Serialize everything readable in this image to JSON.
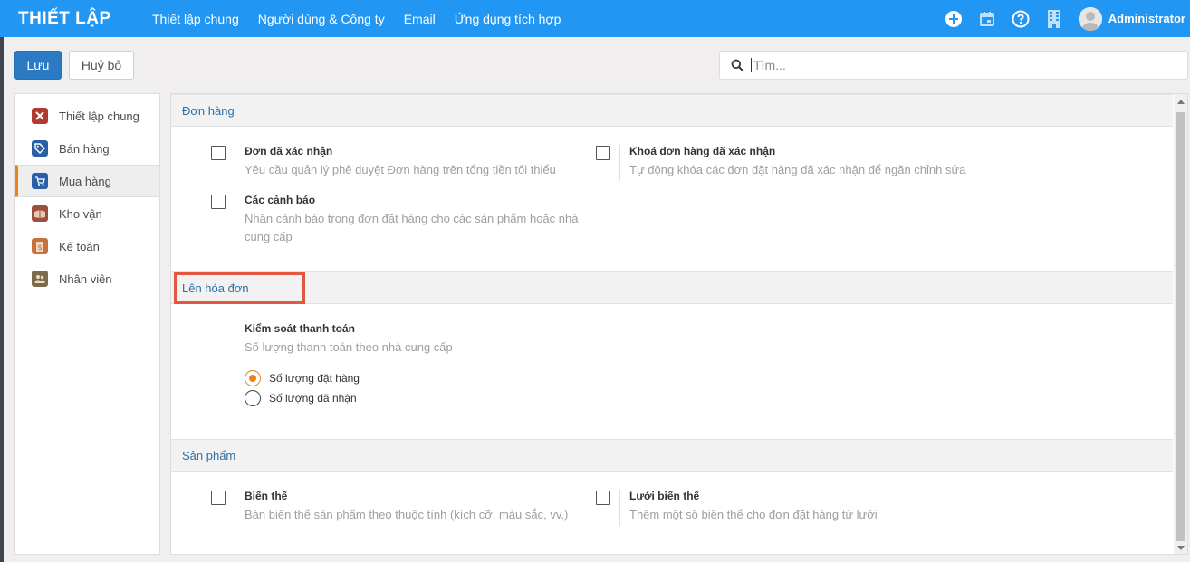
{
  "topbar": {
    "brand": "THIẾT LẬP",
    "nav": [
      "Thiết lập chung",
      "Người dùng & Công ty",
      "Email",
      "Ứng dụng tích hợp"
    ],
    "icons": [
      "plus-circle-icon",
      "calendar-icon",
      "help-icon",
      "building-icon"
    ],
    "user": "Administrator"
  },
  "toolbar": {
    "save_label": "Lưu",
    "cancel_label": "Huỷ bỏ"
  },
  "search": {
    "placeholder": "Tìm..."
  },
  "sidebar": {
    "items": [
      {
        "label": "Thiết lập chung",
        "icon": "tools-icon",
        "color": "#b03a2e"
      },
      {
        "label": "Bán hàng",
        "icon": "tag-icon",
        "color": "#2a5fa8"
      },
      {
        "label": "Mua hàng",
        "icon": "cart-icon",
        "color": "#2a5fa8",
        "active": true
      },
      {
        "label": "Kho vận",
        "icon": "boxes-icon",
        "color": "#9b4f3f"
      },
      {
        "label": "Kế toán",
        "icon": "invoice-icon",
        "color": "#c8703e"
      },
      {
        "label": "Nhân viên",
        "icon": "people-icon",
        "color": "#7d6a4c"
      }
    ]
  },
  "sections": {
    "orders": {
      "title": "Đơn hàng",
      "settings": [
        {
          "title": "Đơn đã xác nhận",
          "desc": "Yêu cầu quản lý phê duyệt Đơn hàng trên tổng tiền tối thiểu",
          "checked": false
        },
        {
          "title": "Khoá đơn hàng đã xác nhận",
          "desc": "Tự động khóa các đơn đặt hàng đã xác nhận để ngăn chỉnh sửa",
          "checked": false
        },
        {
          "title": "Các cảnh báo",
          "desc_line1": "Nhận cảnh báo trong đơn đặt hàng cho các sản phẩm hoặc nhà",
          "desc_line2": "cung cấp",
          "checked": false
        }
      ]
    },
    "invoicing": {
      "title": "Lên hóa đơn",
      "setting": {
        "title": "Kiểm soát thanh toán",
        "desc": "Số lượng thanh toán theo nhà cung cấp",
        "options": [
          {
            "label": "Số lượng đặt hàng",
            "selected": true
          },
          {
            "label": "Số lượng đã nhận",
            "selected": false
          }
        ]
      }
    },
    "products": {
      "title": "Sản phẩm",
      "settings": [
        {
          "title": "Biến thể",
          "desc": "Bán biến thể sản phẩm theo thuộc tính (kích cỡ, màu sắc, vv.)",
          "checked": false
        },
        {
          "title": "Lưới biến thể",
          "desc": "Thêm một số biến thể cho đơn đặt hàng từ lưới",
          "checked": false
        }
      ]
    }
  },
  "colors": {
    "topbar": "#2196f3",
    "primary_button": "#2b7bc4",
    "active_accent": "#e8841c",
    "highlight_box": "#e3563f",
    "section_title": "#2c6ea6"
  }
}
